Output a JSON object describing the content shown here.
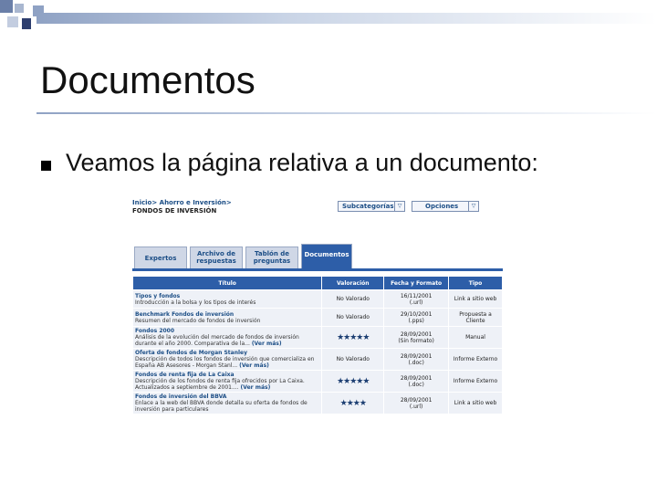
{
  "slide": {
    "title": "Documentos",
    "bullet": "Veamos la página relativa a un documento:"
  },
  "colors": {
    "accent": "#2d5ea8",
    "header_gradient": "#8fa2c4"
  },
  "screenshot": {
    "breadcrumb": "Inicio> Ahorro e Inversión>",
    "current_section": "FONDOS DE INVERSIÓN",
    "subcategorias_label": "Subcategorías",
    "opciones_label": "Opciones",
    "tabs": [
      {
        "label": "Expertos"
      },
      {
        "label": "Archivo de respuestas"
      },
      {
        "label": "Tablón de preguntas"
      },
      {
        "label": "Documentos"
      }
    ],
    "table": {
      "headers": [
        "Título",
        "Valoración",
        "Fecha y Formato",
        "Tipo"
      ],
      "rows": [
        {
          "title": "Tipos y fondos",
          "desc": "Introducción a la bolsa y los tipos de interés",
          "more": "",
          "rating": "No Valorado",
          "stars": 0,
          "date": "16/11/2001",
          "format": "(.url)",
          "type": "Link a sitio web"
        },
        {
          "title": "Benchmark Fondos de inversión",
          "desc": "Resumen del mercado de fondos de inversión",
          "more": "",
          "rating": "No Valorado",
          "stars": 0,
          "date": "29/10/2001",
          "format": "(.pps)",
          "type": "Propuesta a Cliente"
        },
        {
          "title": "Fondos 2000",
          "desc": "Análisis de la evolución del mercado de fondos de inversión durante el año 2000. Comparativa de la...",
          "more": "(Ver más)",
          "rating": "",
          "stars": 5,
          "date": "28/09/2001",
          "format": "(Sin formato)",
          "type": "Manual"
        },
        {
          "title": "Oferta de fondos de Morgan Stanley",
          "desc": "Descripción de todos los fondos de inversión que comercializa en España AB Asesores - Morgan Stanl...",
          "more": "(Ver más)",
          "rating": "No Valorado",
          "stars": 0,
          "date": "28/09/2001",
          "format": "(.doc)",
          "type": "Informe Externo"
        },
        {
          "title": "Fondos de renta fija de La Caixa",
          "desc": "Descripción de los fondos de renta fija ofrecidos por La Caixa. Actualizados a septiembre de 2001....",
          "more": "(Ver más)",
          "rating": "",
          "stars": 5,
          "date": "28/09/2001",
          "format": "(.doc)",
          "type": "Informe Externo"
        },
        {
          "title": "Fondos de inversión del BBVA",
          "desc": "Enlace a la web del BBVA donde detalla su oferta de fondos de inversión para particulares",
          "more": "",
          "rating": "",
          "stars": 4,
          "date": "28/09/2001",
          "format": "(.url)",
          "type": "Link a sitio web"
        }
      ]
    }
  }
}
